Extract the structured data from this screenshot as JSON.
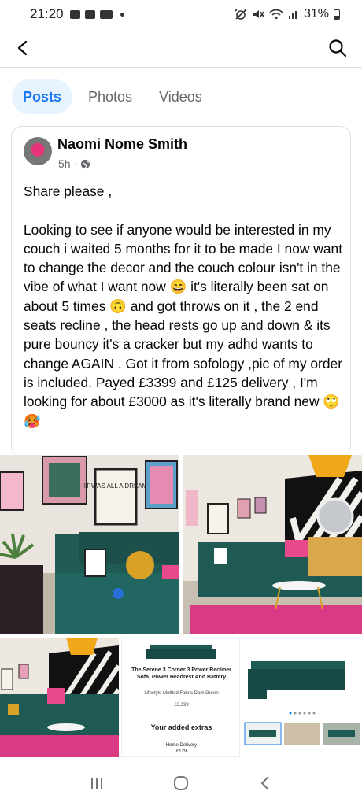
{
  "status_bar": {
    "time": "21:20",
    "battery": "31%",
    "left_icons": [
      "gallery-icon",
      "facebook-icon",
      "cs-icon",
      "dot-icon"
    ],
    "right_icons": [
      "alarm-icon",
      "mute-icon",
      "wifi-icon",
      "signal-icon",
      "battery-icon"
    ]
  },
  "nav": {
    "back_icon": "back-arrow-icon",
    "search_icon": "search-icon"
  },
  "tabs": [
    {
      "label": "Posts",
      "active": true
    },
    {
      "label": "Photos",
      "active": false
    },
    {
      "label": "Videos",
      "active": false
    }
  ],
  "post": {
    "author": "Naomi Nome Smith",
    "time": "5h",
    "audience_icon": "globe-icon",
    "text": "Share please ,\n\nLooking to see if anyone would be interested in my couch i waited 5 months for it to be made I now want to change the decor and the couch colour isn't in the vibe of what I want now 😄 it's literally been sat on about 5 times 🙃  and got throws on it , the 2 end seats recline , the head rests go up and down & its pure bouncy it's a cracker but my adhd wants to change AGAIN . Got it from sofology ,pic of my order is included. Payed £3399 and £125 delivery , I'm looking for about £3000 as it's literally brand new 🙄🥵"
  },
  "photos": {
    "living_room_prints": [
      "IT WAS ALL A DREAM"
    ],
    "product": {
      "title": "The Serene 3 Corner 3 Power Recliner Sofa, Power Headrest And Battery",
      "subtitle": "Lifestyle Mottled Fabric Dark Green",
      "price": "£3,399",
      "extras_heading": "Your added extras",
      "delivery_label": "Home Delivery",
      "delivery_price": "£129"
    }
  },
  "bottom_nav": {
    "recents_icon": "recents-icon",
    "home_icon": "home-icon",
    "back_icon": "back-icon"
  },
  "colors": {
    "accent": "#1877f2",
    "active_tab_bg": "#e7f3ff",
    "text": "#050505",
    "muted": "#65676b",
    "sofa_green": "#1f5a55"
  }
}
